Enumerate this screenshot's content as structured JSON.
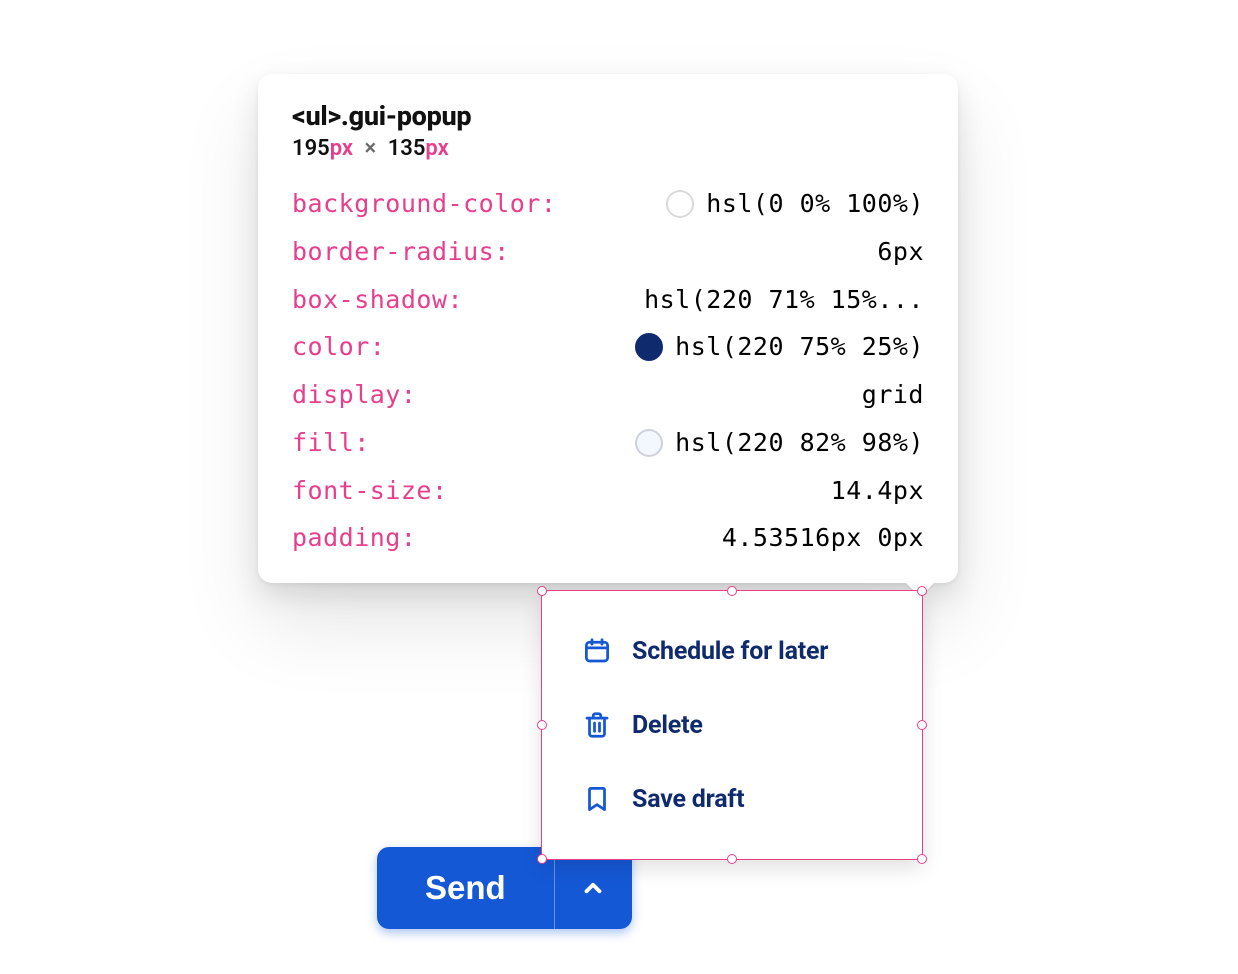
{
  "inspector": {
    "selector": "<ul>.gui-popup",
    "width_num": "195",
    "height_num": "135",
    "px": "px",
    "times": "×",
    "props": {
      "background_color": {
        "key": "background-color",
        "value": "hsl(0 0% 100%)"
      },
      "border_radius": {
        "key": "border-radius",
        "value": "6px"
      },
      "box_shadow": {
        "key": "box-shadow",
        "value": "hsl(220 71% 15%..."
      },
      "color": {
        "key": "color",
        "value": "hsl(220 75% 25%)"
      },
      "display": {
        "key": "display",
        "value": "grid"
      },
      "fill": {
        "key": "fill",
        "value": "hsl(220 82% 98%)"
      },
      "font_size": {
        "key": "font-size",
        "value": "14.4px"
      },
      "padding": {
        "key": "padding",
        "value": "4.53516px 0px"
      }
    }
  },
  "popup": {
    "items": [
      {
        "label": "Schedule for later"
      },
      {
        "label": "Delete"
      },
      {
        "label": "Save draft"
      }
    ]
  },
  "send": {
    "label": "Send"
  }
}
